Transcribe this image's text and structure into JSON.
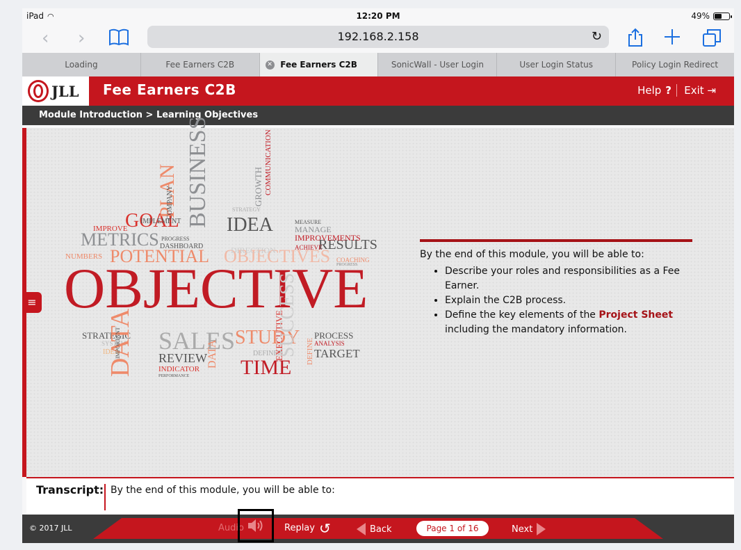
{
  "status_bar": {
    "device": "iPad",
    "time": "12:20 PM",
    "battery": "49%",
    "battery_level": 0.49
  },
  "browser": {
    "url": "192.168.2.158",
    "tabs": [
      {
        "label": "Loading"
      },
      {
        "label": "Fee Earners C2B"
      },
      {
        "label": "Fee Earners C2B",
        "active": true
      },
      {
        "label": "SonicWall - User Login"
      },
      {
        "label": "User Login Status"
      },
      {
        "label": "Policy Login Redirect"
      }
    ]
  },
  "app": {
    "logo_text": "JLL",
    "title": "Fee Earners C2B",
    "help_label": "Help",
    "help_glyph": "?",
    "exit_label": "Exit",
    "accent_color": "#c5161e",
    "breadcrumb": "Module Introduction > Learning Objectives"
  },
  "word_cloud": {
    "words": [
      "OBJECTIVE",
      "GOAL",
      "PLAN",
      "BUSINESS",
      "IDEA",
      "METRICS",
      "POTENTIAL",
      "OBJECTIVES",
      "RESULTS",
      "IMPROVEMENTS",
      "COMMUNICATION",
      "GROWTH",
      "MANAGE",
      "IMPROVE",
      "IMPLEMENT",
      "COMPANY",
      "PROGRESS",
      "DASHBOARD",
      "NUMBERS",
      "STRATEGY",
      "MEASURE",
      "ACHIEVE",
      "DIRECTION",
      "COACHING",
      "PROGRESS",
      "STRATEGIC",
      "SYSTEM",
      "IDEA",
      "SALES",
      "STUDY",
      "PROCESS",
      "ANALYSIS",
      "TARGET",
      "REVIEW",
      "INDICATOR",
      "PERFORMANCE",
      "DATA",
      "DATA",
      "DEFINED",
      "TIME",
      "EXECUTIVE",
      "SUCCESS",
      "DEFINE",
      "IMPORTANT"
    ]
  },
  "objectives": {
    "intro": "By the end of this module, you will be able to:",
    "items": [
      {
        "text": "Describe your roles and responsibilities as a Fee Earner."
      },
      {
        "text": "Explain the C2B process."
      },
      {
        "pre": "Define the key elements of the ",
        "highlight": "Project Sheet",
        "post": " including the mandatory information."
      }
    ]
  },
  "transcript": {
    "label": "Transcript:",
    "text": "By the end of this module, you will be able to:"
  },
  "footer": {
    "copyright": "© 2017 JLL",
    "audio_label": "Audio",
    "replay_label": "Replay",
    "back_label": "Back",
    "page_indicator": "Page 1 of 16",
    "next_label": "Next"
  }
}
